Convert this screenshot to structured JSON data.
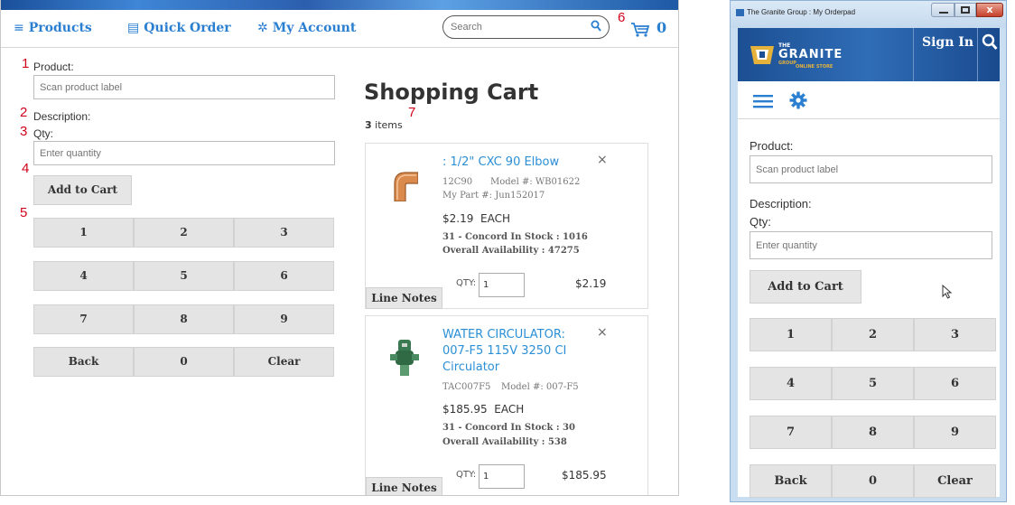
{
  "left": {
    "nav": {
      "products_icon": "≡",
      "products": "Products",
      "quick_order_icon": "▤",
      "quick_order": "Quick Order",
      "my_account_icon": "✲",
      "my_account": "My Account",
      "search_placeholder": "Search",
      "cart_count": "0"
    },
    "form": {
      "product_label": "Product:",
      "product_placeholder": "Scan product label",
      "description_label": "Description:",
      "qty_label": "Qty:",
      "qty_placeholder": "Enter quantity",
      "add_to_cart": "Add to Cart"
    },
    "keypad": [
      "1",
      "2",
      "3",
      "4",
      "5",
      "6",
      "7",
      "8",
      "9",
      "Back",
      "0",
      "Clear"
    ],
    "annotations": [
      "1",
      "2",
      "3",
      "4",
      "5",
      "6",
      "7"
    ],
    "cart": {
      "title": "Shopping Cart",
      "items_count": "3",
      "items_label": "items",
      "remove": "×",
      "qty_label": "QTY:",
      "line_notes": "Line Notes",
      "items": [
        {
          "title": ": 1/2\" CXC 90 Elbow",
          "sku": "12C90",
          "model": "Model #: WB01622",
          "mypart": "My Part #: Jun152017",
          "price": "$2.19  EACH",
          "stock": "31 - Concord In Stock : 1016",
          "availability": "Overall Availability : 47275",
          "qty": "1",
          "total": "$2.19"
        },
        {
          "title": "WATER CIRCULATOR: 007-F5 115V 3250 CI Circulator",
          "sku": "TAC007F5",
          "model": "Model #: 007-F5",
          "price": "$185.95  EACH",
          "stock": "31 - Concord In Stock : 30",
          "availability": "Overall Availability : 538",
          "qty": "1",
          "total": "$185.95"
        }
      ]
    }
  },
  "right": {
    "window_title": "The Granite Group : My Orderpad",
    "logo_text": "GRANITE",
    "logo_small_top": "THE",
    "logo_small_mid": "GROUP",
    "logo_small_bottom": "ONLINE STORE",
    "sign_in": "Sign In",
    "product_label": "Product:",
    "product_placeholder": "Scan product label",
    "description_label": "Description:",
    "qty_label": "Qty:",
    "qty_placeholder": "Enter quantity",
    "add_to_cart": "Add to Cart",
    "keypad": [
      "1",
      "2",
      "3",
      "4",
      "5",
      "6",
      "7",
      "8",
      "9",
      "Back",
      "0",
      "Clear"
    ]
  },
  "colors": {
    "accent": "#2b7fd1",
    "link": "#2b8fd6",
    "annotation": "#d0021b",
    "banner": "#1c4f93"
  }
}
